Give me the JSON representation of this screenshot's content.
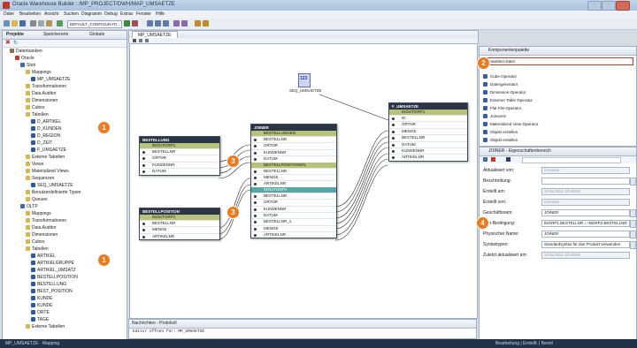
{
  "window": {
    "title": "Oracle Warehouse Builder : /MP_PROJECT/DWH/MAP_UMSAETZE"
  },
  "menubar": [
    "Datei",
    "Bearbeiten",
    "Ansicht",
    "Suchen",
    "Diagramm",
    "Debug",
    "Extras",
    "Fenster",
    "Hilfe"
  ],
  "toolbar": {
    "config_value": "DEFAULT_CONFIGURATI..."
  },
  "left_panel": {
    "tabs": [
      "Projekte",
      "Speicherorte",
      "Globale"
    ],
    "tree": [
      {
        "label": "Datenbanken",
        "depth": 1
      },
      {
        "label": "Oracle",
        "depth": 2
      },
      {
        "label": "Stori",
        "depth": 3
      },
      {
        "label": "Mappings",
        "depth": 4
      },
      {
        "label": "MP_UMSAETZE",
        "depth": 5
      },
      {
        "label": "Transformationen",
        "depth": 4
      },
      {
        "label": "Data Auditor",
        "depth": 4
      },
      {
        "label": "Dimensionen",
        "depth": 4
      },
      {
        "label": "Cubes",
        "depth": 4
      },
      {
        "label": "Tabellen",
        "depth": 4
      },
      {
        "label": "D_ARTIKEL",
        "depth": 5
      },
      {
        "label": "D_KUNDEN",
        "depth": 5
      },
      {
        "label": "D_REGION",
        "depth": 5
      },
      {
        "label": "D_ZEIT",
        "depth": 5
      },
      {
        "label": "F_UMSAETZE",
        "depth": 5
      },
      {
        "label": "Externe Tabellen",
        "depth": 4
      },
      {
        "label": "Views",
        "depth": 4
      },
      {
        "label": "Materialized Views",
        "depth": 4
      },
      {
        "label": "Sequenzen",
        "depth": 4
      },
      {
        "label": "SEQ_UMSAETZE",
        "depth": 5
      },
      {
        "label": "Benutzerdefinierte Typen",
        "depth": 4
      },
      {
        "label": "Queues",
        "depth": 4
      },
      {
        "label": "OLTP",
        "depth": 3
      },
      {
        "label": "Mappings",
        "depth": 4
      },
      {
        "label": "Transformationen",
        "depth": 4
      },
      {
        "label": "Data Auditor",
        "depth": 4
      },
      {
        "label": "Dimensionen",
        "depth": 4
      },
      {
        "label": "Cubes",
        "depth": 4
      },
      {
        "label": "Tabellen",
        "depth": 4
      },
      {
        "label": "ARTIKEL",
        "depth": 5
      },
      {
        "label": "ARTIKELGRUPPE",
        "depth": 5
      },
      {
        "label": "ARTIKEL_UMSATZ",
        "depth": 5
      },
      {
        "label": "BESTELLPOSITION",
        "depth": 5
      },
      {
        "label": "BESTELLUNG",
        "depth": 5
      },
      {
        "label": "BEST_POSITION",
        "depth": 5
      },
      {
        "label": "KUNDE",
        "depth": 5
      },
      {
        "label": "KUNDE",
        "depth": 5
      },
      {
        "label": "ORTE",
        "depth": 5
      },
      {
        "label": "TAGE",
        "depth": 5
      },
      {
        "label": "Externe Tabellen",
        "depth": 4
      }
    ]
  },
  "editor": {
    "tab": "MP_UMSAETZE",
    "sequence_label": "SEQ_UMSAETZE",
    "tables": {
      "bestellung": {
        "title": "BESTELLUNG",
        "group": "INOUTGRP1",
        "rows": [
          "BESTELLNR",
          "ORTNR",
          "KUNDENNR",
          "DATUM"
        ]
      },
      "bestellposition": {
        "title": "BESTELLPOSITION",
        "group": "INOUTGRP1",
        "rows": [
          "BESTELLNR",
          "MENGE",
          "ARTIKELNR"
        ]
      },
      "joiner": {
        "title": "JOINER",
        "group1": "BESTELLUNGEN",
        "rows1": [
          "BESTELLNR",
          "ORTNR",
          "KUNDENNR",
          "DATUM"
        ],
        "group2": "BESTELLPOSITIONEN",
        "rows2": [
          "BESTELLNR",
          "MENGE",
          "ARTIKELNR"
        ],
        "group3": "INOUTGRP1",
        "rows3": [
          "BESTELLNR",
          "ORTNR",
          "KUNDENNR",
          "DATUM",
          "BESTELLNR_1",
          "MENGE",
          "ARTIKELNR"
        ]
      },
      "f_umsaetze": {
        "title": "F_UMSAETZE",
        "group": "INOUTGRP1",
        "rows": [
          "ID",
          "ORTNR",
          "MENGE",
          "BESTELLNR",
          "DATUM",
          "KUNDENNR",
          "ARTIKELNR"
        ]
      }
    }
  },
  "log_panel": {
    "tab": "Nachrichten - Protokoll",
    "text": "Editor öffnen für: MP_UMSAETZE",
    "footer": "Nachrichten"
  },
  "right_panel": {
    "palette_title": "Komponentenpalette",
    "palette_search": "Mapwahlen-Datei",
    "palette_items": [
      "Cube-Operator",
      "Datengenerator",
      "Dimension-Operator",
      "Externer Table Operator",
      "Flat File-Operator",
      "Joinserie",
      "Materialized View-Operator",
      "Objekt erstellen",
      "Objekt erstellen"
    ],
    "props_title": "JOINER - Eigenschaftenbereich",
    "props": [
      {
        "label": "Aktualisiert von:",
        "value": "mmuster",
        "disabled": true
      },
      {
        "label": "Beschreibung:",
        "value": "",
        "disabled": false
      },
      {
        "label": "Erstellt am:",
        "value": "10.04.2011 10:45:55",
        "disabled": true
      },
      {
        "label": "Erstellt von:",
        "value": "mmuster",
        "disabled": true
      },
      {
        "label": "Geschäftsnam:",
        "value": "JOINER",
        "disabled": false
      },
      {
        "label": "Join-Bedingung:",
        "value": "INGRP1.BESTELLNR = INGRP2.BESTELLNR",
        "disabled": false
      },
      {
        "label": "Physischer Name:",
        "value": "JOINER",
        "disabled": false
      },
      {
        "label": "Syntaxtypen:",
        "value": "Standardsyntax für das Produkt verwenden",
        "disabled": false
      },
      {
        "label": "Zuletzt aktualisiert am:",
        "value": "10.04.2011 10:45:55",
        "disabled": true
      }
    ]
  },
  "callouts": [
    "1",
    "2",
    "3",
    "3",
    "4",
    "1"
  ],
  "statusbar": {
    "left": "MP_UMSAETZE · Mapping",
    "right": "Bearbeitung | Erstellt: | Bereit"
  }
}
